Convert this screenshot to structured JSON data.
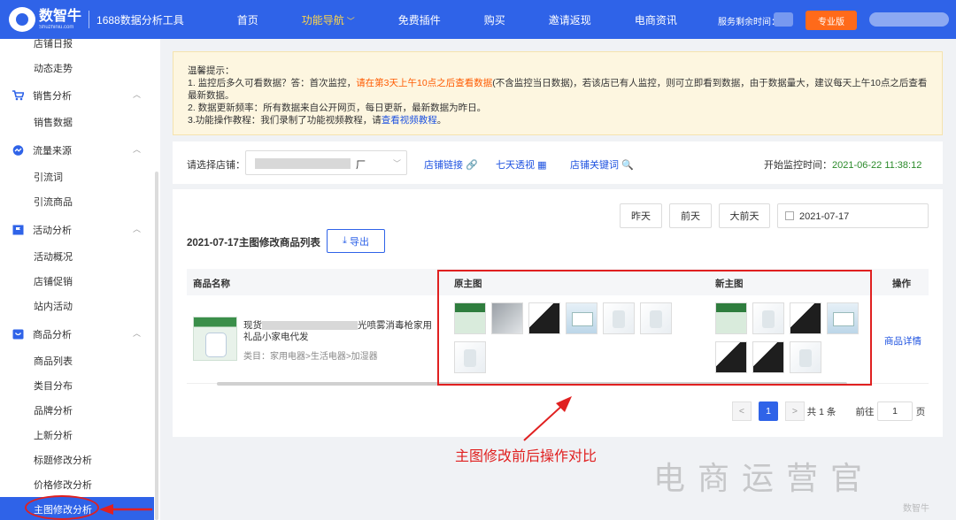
{
  "topbar": {
    "brand": "数智牛",
    "brand_sub": "Shuzhiniu.com",
    "tool_name": "1688数据分析工具",
    "nav": [
      "首页",
      "功能导航",
      "免费插件",
      "购买",
      "邀请返现",
      "电商资讯"
    ],
    "service_label": "服务剩余时间：",
    "plan_button": "专业版"
  },
  "sidebar": {
    "cut_item": "店铺日报",
    "items": [
      {
        "type": "sub",
        "label": "动态走势"
      },
      {
        "type": "group",
        "label": "销售分析",
        "icon": "cart-icon"
      },
      {
        "type": "sub",
        "label": "销售数据"
      },
      {
        "type": "group",
        "label": "流量来源",
        "icon": "traffic-icon"
      },
      {
        "type": "sub",
        "label": "引流词"
      },
      {
        "type": "sub",
        "label": "引流商品"
      },
      {
        "type": "group",
        "label": "活动分析",
        "icon": "flag-icon"
      },
      {
        "type": "sub",
        "label": "活动概况"
      },
      {
        "type": "sub",
        "label": "店铺促销"
      },
      {
        "type": "sub",
        "label": "站内活动"
      },
      {
        "type": "group",
        "label": "商品分析",
        "icon": "goods-icon"
      },
      {
        "type": "sub",
        "label": "商品列表"
      },
      {
        "type": "sub",
        "label": "类目分布"
      },
      {
        "type": "sub",
        "label": "品牌分析"
      },
      {
        "type": "sub",
        "label": "上新分析"
      },
      {
        "type": "sub",
        "label": "标题修改分析"
      },
      {
        "type": "sub",
        "label": "价格修改分析"
      }
    ],
    "active_item": "主图修改分析"
  },
  "notice": {
    "title": "温馨提示：",
    "line1_pre": "1. 监控后多久可看数据？答：首次监控，",
    "line1_highlight": "请在第3天上午10点之后查看数据",
    "line1_post": "(不含监控当日数据)，若该店已有人监控，则可立即看到数据，由于数据量大，建议每天上午10点之后查看最新数据。",
    "line2": "2. 数据更新频率：所有数据来自公开网页，每日更新，最新数据为昨日。",
    "line3_pre": "3.功能操作教程：我们录制了功能视频教程，请",
    "line3_link": "查看视频教程",
    "line3_post": "。"
  },
  "storebar": {
    "label": "请选择店铺：",
    "store_suffix": "厂",
    "links": [
      "店铺链接",
      "七天透视",
      "店铺关键词"
    ],
    "monitor_label": "开始监控时间：",
    "monitor_time": "2021-06-22 11:38:12"
  },
  "panel": {
    "date_buttons": [
      "昨天",
      "前天",
      "大前天"
    ],
    "date_value": "2021-07-17",
    "list_title": "2021-07-17主图修改商品列表",
    "export_label": "导出",
    "columns": [
      "商品名称",
      "原主图",
      "新主图",
      "操作"
    ],
    "row": {
      "name_pre": "现货",
      "name_post": "光喷雾消毒枪家用礼品小家电代发",
      "category": "类目：家用电器>生活电器>加湿器",
      "action": "商品详情",
      "old_images": [
        "green",
        "gray",
        "black",
        "blue",
        "white",
        "white",
        "white"
      ],
      "new_images": [
        "green",
        "white",
        "black",
        "blue",
        "black",
        "black",
        "white"
      ]
    },
    "pagination": {
      "prev": "<",
      "current": "1",
      "next": ">",
      "total": "共 1 条",
      "goto_label": "前往",
      "goto_value": "1",
      "page_unit": "页"
    }
  },
  "annotation": {
    "text": "主图修改前后操作对比",
    "color": "#e02020"
  },
  "watermark": {
    "text": "电商运营官",
    "sub": "数智牛"
  },
  "colors": {
    "brand": "#2f63e8",
    "nav_active": "#ffd54a",
    "orange": "#ff6a1a",
    "link": "#1f53e0",
    "green_time": "#2a8a2a"
  }
}
